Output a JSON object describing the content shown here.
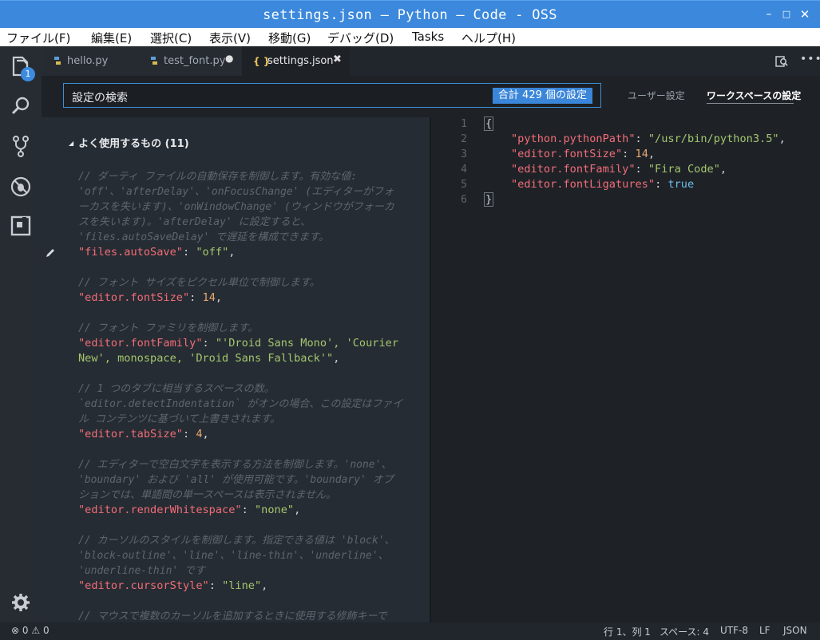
{
  "window": {
    "title": "settings.json — Python — Code - OSS"
  },
  "menu": [
    "ファイル(F)",
    "編集(E)",
    "選択(C)",
    "表示(V)",
    "移動(G)",
    "デバッグ(D)",
    "Tasks",
    "ヘルプ(H)"
  ],
  "activity": {
    "explorer_badge": "1"
  },
  "tabs": [
    {
      "label": "hello.py"
    },
    {
      "label": "test_font.py"
    },
    {
      "label": "settings.json"
    }
  ],
  "settings": {
    "search_placeholder": "設定の検索",
    "count_badge": "合計 429 個の設定",
    "user_tab": "ユーザー設定",
    "workspace_tab": "ワークスペースの設定",
    "section_title": "よく使用するもの (11)"
  },
  "defaults": {
    "c1": [
      "// ダーティ ファイルの自動保存を制御します。有効な値:",
      "'off'、'afterDelay'、'onFocusChange' (エディターがフォ",
      "ーカスを失います)、'onWindowChange' (ウィンドウがフォーカ",
      "スを失います)。'afterDelay' に設定すると、",
      "'files.autoSaveDelay' で遅延を構成できます。"
    ],
    "k1": "\"files.autoSave\"",
    "v1": "\"off\"",
    "c2": "// フォント サイズをピクセル単位で制御します。",
    "k2": "\"editor.fontSize\"",
    "v2": "14",
    "c3": "// フォント ファミリを制御します。",
    "k3": "\"editor.fontFamily\"",
    "v3a": "\"'Droid Sans Mono', 'Courier",
    "v3b": "New', monospace, 'Droid Sans Fallback'\"",
    "c4": [
      "// 1 つのタブに相当するスペースの数。",
      "`editor.detectIndentation` がオンの場合、この設定はファイ",
      "ル コンテンツに基づいて上書きされます。"
    ],
    "k4": "\"editor.tabSize\"",
    "v4": "4",
    "c5": [
      "// エディターで空白文字を表示する方法を制御します。'none'、",
      "'boundary' および 'all' が使用可能です。'boundary' オプ",
      "ションでは、単語間の単一スペースは表示されません。"
    ],
    "k5": "\"editor.renderWhitespace\"",
    "v5": "\"none\"",
    "c6": [
      "// カーソルのスタイルを制御します。指定できる値は 'block'、",
      "'block-outline'、'line'、'line-thin'、'underline'、",
      "'underline-thin' です"
    ],
    "k6": "\"editor.cursorStyle\"",
    "v6": "\"line\"",
    "c7": "// マウスで複数のカーソルを追加するときに使用する修飾キーで"
  },
  "editor": {
    "line_numbers": [
      "1",
      "2",
      "3",
      "4",
      "5",
      "6"
    ],
    "open_brace": "{",
    "close_brace": "}",
    "k1": "\"python.pythonPath\"",
    "v1": "\"/usr/bin/python3.5\"",
    "k2": "\"editor.fontSize\"",
    "v2": "14",
    "k3": "\"editor.fontFamily\"",
    "v3": "\"Fira Code\"",
    "k4": "\"editor.fontLigatures\"",
    "v4": "true"
  },
  "status": {
    "errors": "0",
    "warnings": "0",
    "position": "行 1、列 1",
    "indent": "スペース: 4",
    "encoding": "UTF-8",
    "eol": "LF",
    "language": "JSON"
  }
}
